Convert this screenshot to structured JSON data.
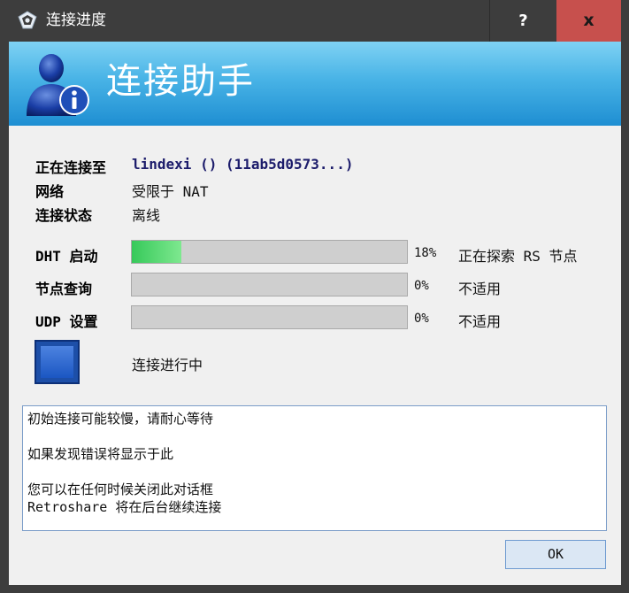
{
  "window": {
    "title": "连接进度",
    "help_label": "?",
    "close_label": "x"
  },
  "banner": {
    "title": "连接助手"
  },
  "info": {
    "connecting_label": "正在连接至",
    "peer_value": "lindexi () (11ab5d0573...)",
    "network_label": "网络",
    "network_value": "受限于 NAT",
    "state_label": "连接状态",
    "state_value": "离线"
  },
  "progress": [
    {
      "label": "DHT 启动",
      "percent": 18,
      "percent_text": "18%",
      "status": "正在探索 RS 节点"
    },
    {
      "label": "节点查询",
      "percent": 0,
      "percent_text": "0%",
      "status": "不适用"
    },
    {
      "label": "UDP 设置",
      "percent": 0,
      "percent_text": "0%",
      "status": "不适用"
    }
  ],
  "activity": {
    "text": "连接进行中"
  },
  "log": {
    "line1": "初始连接可能较慢，请耐心等待",
    "line2": "如果发现错误将显示于此",
    "line3": "您可以在任何时候关闭此对话框",
    "line4": "Retroshare 将在后台继续连接"
  },
  "buttons": {
    "ok": "OK"
  },
  "colors": {
    "banner_top": "#7fd2f4",
    "banner_bottom": "#1e8ed2",
    "close_button": "#c7504d",
    "progress_fill": "#36c95a",
    "activity_square": "#1d4fa8"
  }
}
